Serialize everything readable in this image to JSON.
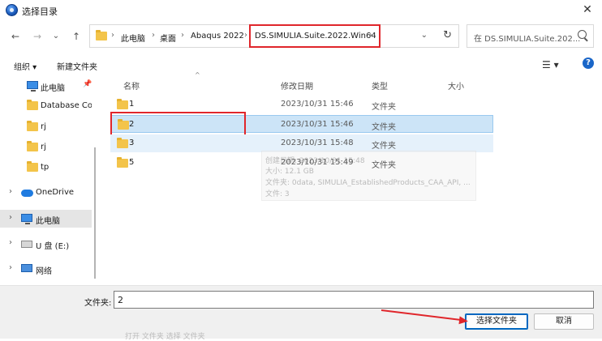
{
  "window": {
    "title": "选择目录",
    "close_glyph": "✕"
  },
  "nav": {
    "back": "←",
    "forward": "→",
    "recent": "⌄",
    "up": "↑",
    "breadcrumb": [
      "此电脑",
      "桌面",
      "Abaqus 2022",
      "DS.SIMULIA.Suite.2022.Win64"
    ],
    "sep": "›",
    "dropdown": "⌄",
    "refresh": "↻",
    "search_placeholder": "在 DS.SIMULIA.Suite.202..."
  },
  "toolbar": {
    "organize": "组织 ▾",
    "new_folder": "新建文件夹",
    "view_glyph": "☰ ▾",
    "help_glyph": "?"
  },
  "sidebar": {
    "items": [
      {
        "label": "此电脑",
        "icon": "pc-icon",
        "pin": "📌"
      },
      {
        "label": "Database Cor",
        "icon": "folder-icon"
      },
      {
        "label": "rj",
        "icon": "folder-icon"
      },
      {
        "label": "rj",
        "icon": "folder-icon"
      },
      {
        "label": "tp",
        "icon": "folder-icon"
      },
      {
        "label": "OneDrive",
        "icon": "cloud-icon",
        "expander": "›"
      },
      {
        "label": "此电脑",
        "icon": "pc-icon",
        "expander": "›"
      },
      {
        "label": "U 盘 (E:)",
        "icon": "drive-icon",
        "expander": "›"
      },
      {
        "label": "网络",
        "icon": "network-icon",
        "expander": "›"
      }
    ]
  },
  "columns": {
    "name": "名称",
    "modified": "修改日期",
    "type": "类型",
    "size": "大小",
    "sort_caret": "^"
  },
  "files": [
    {
      "name": "1",
      "modified": "2023/10/31 15:46",
      "type": "文件夹"
    },
    {
      "name": "2",
      "modified": "2023/10/31 15:46",
      "type": "文件夹"
    },
    {
      "name": "3",
      "modified": "2023/10/31 15:48",
      "type": "文件夹"
    },
    {
      "name": "5",
      "modified": "2023/10/31 15:49",
      "type": "文件夹"
    }
  ],
  "tooltip": {
    "line1": "创建日期: 2023/10/31 15:48",
    "line2": "大小: 12.1 GB",
    "line3": "文件夹: 0data, SIMULIA_EstablishedProducts_CAA_API, ...",
    "line4": "文件: 3"
  },
  "bottom": {
    "folder_label": "文件夹:",
    "folder_value": "2",
    "select_button": "选择文件夹",
    "cancel_button": "取消",
    "bleed": "打开 文件夹  选择 文件夹"
  },
  "colors": {
    "highlight_red": "#e0262b",
    "selection_blue": "#cce4f7",
    "primary_button_border": "#0067c0"
  }
}
